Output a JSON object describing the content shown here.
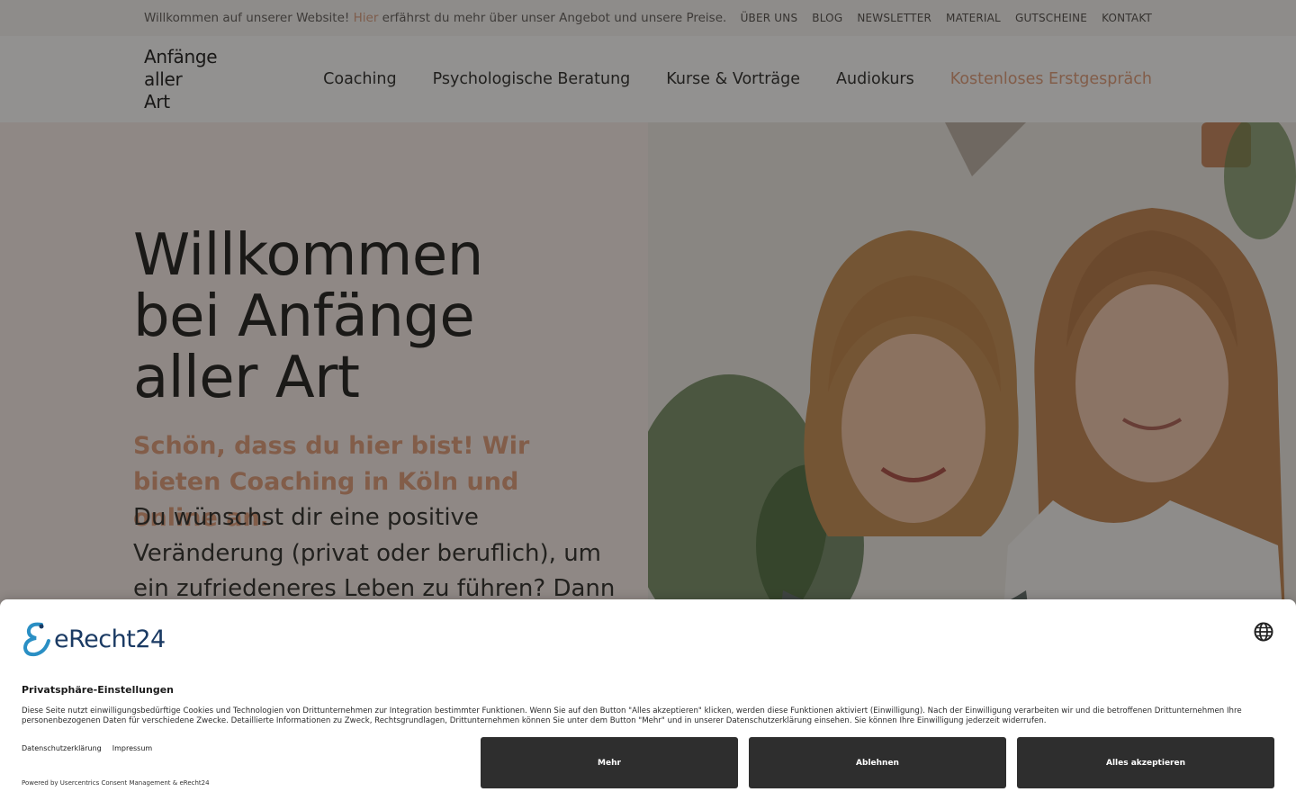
{
  "topbar": {
    "notice_before": "Willkommen auf unserer Website! ",
    "notice_link": "Hier",
    "notice_after": " erfährst du mehr über unser Angebot und unsere Preise.",
    "links": [
      "ÜBER UNS",
      "BLOG",
      "NEWSLETTER",
      "MATERIAL",
      "GUTSCHEINE",
      "KONTAKT"
    ]
  },
  "header": {
    "logo_lines": [
      "Anfänge",
      "aller",
      "Art"
    ],
    "nav": [
      "Coaching",
      "Psychologische Beratung",
      "Kurse & Vorträge",
      "Audiokurs"
    ],
    "nav_cta": "Kostenloses Erstgespräch"
  },
  "hero": {
    "title_lines": [
      "Willkommen",
      "bei Anfänge",
      "aller Art"
    ],
    "subtitle": "Schön, dass du hier bist! Wir bieten Coaching in Köln und online an.",
    "body": "Du wünschst dir eine positive Veränderung (privat oder beruflich), um ein zufriedeneres Leben zu führen? Dann bist Du bei uns genau"
  },
  "consent": {
    "brand": "eRecht24",
    "title": "Privatsphäre-Einstellungen",
    "text": "Diese Seite nutzt einwilligungsbedürftige Cookies und Technologien von Drittunternehmen zur Integration bestimmter Funktionen. Wenn Sie auf den Button \"Alles akzeptieren\" klicken, werden diese Funktionen aktiviert (Einwilligung). Nach der Einwilligung verarbeiten wir und die betroffenen Drittunternehmen Ihre personenbezogenen Daten für verschiedene Zwecke. Detaillierte Informationen zu Zweck, Rechtsgrundlagen, Drittunternehmen können Sie unter dem Button \"Mehr\" und in unserer Datenschutzerklärung einsehen. Sie können Ihre Einwilligung jederzeit widerrufen.",
    "link_privacy": "Datenschutzerklärung",
    "link_imprint": "Impressum",
    "powered": "Powered by Usercentrics Consent Management & eRecht24",
    "btn_more": "Mehr",
    "btn_decline": "Ablehnen",
    "btn_accept": "Alles akzeptieren"
  },
  "colors": {
    "accent": "#e0a07f",
    "hero_bg": "#f6ebe6",
    "button_bg": "#2e2e2e",
    "brand_blue": "#1a3a63"
  },
  "icons": {
    "language": "globe-icon",
    "brand": "erecht24-logo-icon"
  }
}
